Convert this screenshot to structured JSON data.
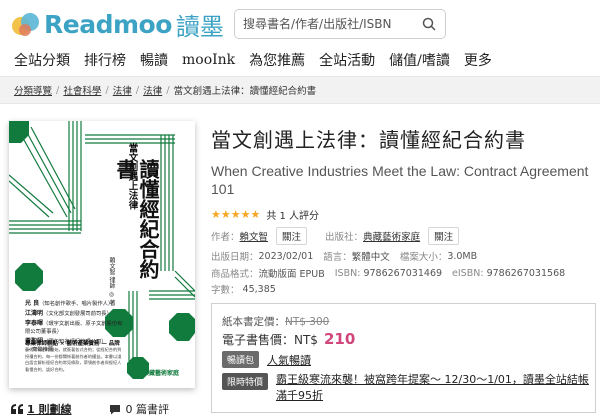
{
  "brand": {
    "name": "Readmoo",
    "cjk": "讀墨",
    "color": "#3da3c4"
  },
  "search": {
    "placeholder": "搜尋書名/作者/出版社/ISBN",
    "icon": "search-icon"
  },
  "nav": {
    "items": [
      "全站分類",
      "排行榜",
      "暢讀",
      "mooInk",
      "為您推薦",
      "全站活動",
      "儲值/嗜讀",
      "更多"
    ]
  },
  "breadcrumb": {
    "items": [
      "分類導覽",
      "社會科學",
      "法律",
      "法律"
    ],
    "current": "當文創遇上法律：讀懂經紀合約書"
  },
  "cover": {
    "small_title": "當文創遇上法律",
    "big_title": "讀懂經紀合約書",
    "author_line": "賴文智 律師 ◎ 著",
    "credits": [
      {
        "name": "光 良",
        "desc": "（知名創作歌手、唱片製作人）"
      },
      {
        "name": "江濤明",
        "desc": "（文化部文創發展司前司長）"
      },
      {
        "name": "李泰暉",
        "desc": "（環宇文創出版、原子文創股份有限公司董事長）"
      },
      {
        "name": "黃聖翊",
        "desc": "（國內知名經紀管理公司）"
      }
    ],
    "credits_suffix": "— 齊聲推薦",
    "tagline": "專業律師觀點 × 藝術產業實務 — 品牌",
    "blurb": "藝術家從創作開始，就簽著各式合約；從經紀合約到授權合約，每一份都關係著創作者的權益。本書以淺白語言解析經紀合約常見條款，帶領創作者與經紀人看懂合約、談好合約。",
    "publisher": "典藏藝術家庭"
  },
  "links": {
    "comments": "1 則劃線",
    "reviews": "0 篇書評"
  },
  "book": {
    "title": "當文創遇上法律：讀懂經紀合約書",
    "subtitle": "When Creative Industries Meet the Law: Contract Agreement 101",
    "stars": "★★★★★",
    "rating_count": "共 1 人評分",
    "author_label": "作者：",
    "author": "賴文智",
    "publisher_label": "出版社：",
    "publisher": "典藏藝術家庭",
    "follow": "關注",
    "pubdate_label": "出版日期：",
    "pubdate": "2023/02/01",
    "language_label": "語言：",
    "language": "繁體中文",
    "filesize_label": "檔案大小：",
    "filesize": "3.0MB",
    "format_label": "商品格式：",
    "format": "流動版面 EPUB",
    "isbn_label": "ISBN:",
    "isbn": "9786267031469",
    "eisbn_label": "eISBN:",
    "eisbn": "9786267031568",
    "words_label": "字數：",
    "words": "45,385"
  },
  "price": {
    "list_label": "紙本書定價：",
    "list_value": "NT$ 300",
    "ebook_label": "電子書售價：NT$",
    "ebook_value": "210",
    "accent": "#d0457a",
    "read_badge": "暢讀包",
    "read_text": "人氣暢讀",
    "promo_badge": "限時特價",
    "promo_text": "霸王級寒流來襲！被窩跨年提案～ 12/30～1/01，讀墨全站結帳滿千95折"
  }
}
